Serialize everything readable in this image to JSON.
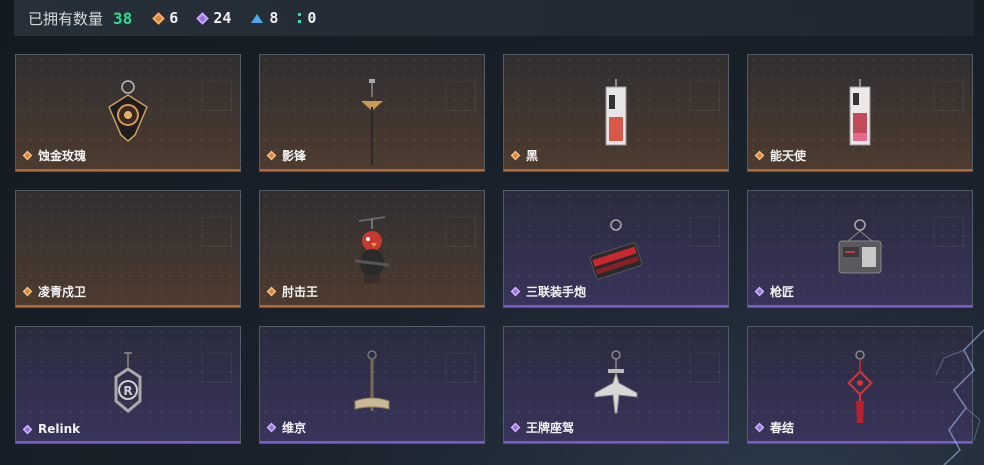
{
  "header": {
    "owned_label": "已拥有数量",
    "owned_count": "38",
    "stats": [
      {
        "icon": "gold-rarity-icon",
        "value": "6",
        "color": "#d9853a"
      },
      {
        "icon": "purple-rarity-icon",
        "value": "24",
        "color": "#9a6fe0"
      },
      {
        "icon": "blue-rarity-icon",
        "value": "8",
        "color": "#4fa6e8"
      },
      {
        "icon": "teal-rarity-icon",
        "value": "0",
        "color": "#3dd6c0"
      }
    ]
  },
  "items": [
    {
      "name": "蚀金玫瑰",
      "rarity": "gold",
      "icon": "rose-pendant-icon"
    },
    {
      "name": "影锋",
      "rarity": "gold",
      "icon": "blade-pendant-icon"
    },
    {
      "name": "黑",
      "rarity": "gold",
      "icon": "card-pendant-icon"
    },
    {
      "name": "能天使",
      "rarity": "gold",
      "icon": "card-pendant-icon"
    },
    {
      "name": "凌青戍卫",
      "rarity": "gold",
      "icon": "empty-slot-icon"
    },
    {
      "name": "肘击王",
      "rarity": "gold",
      "icon": "chicken-figure-icon"
    },
    {
      "name": "三联装手炮",
      "rarity": "purple",
      "icon": "cannon-pendant-icon"
    },
    {
      "name": "枪匠",
      "rarity": "purple",
      "icon": "gun-case-pendant-icon"
    },
    {
      "name": "Relink",
      "rarity": "purple",
      "icon": "relink-emblem-icon"
    },
    {
      "name": "维京",
      "rarity": "purple",
      "icon": "viking-axe-icon"
    },
    {
      "name": "王牌座驾",
      "rarity": "purple",
      "icon": "jet-pendant-icon"
    },
    {
      "name": "春结",
      "rarity": "purple",
      "icon": "chinese-knot-icon"
    }
  ],
  "colors": {
    "accent_count": "#34d98f",
    "gold": "#d9853a",
    "purple": "#9a6fe0"
  }
}
